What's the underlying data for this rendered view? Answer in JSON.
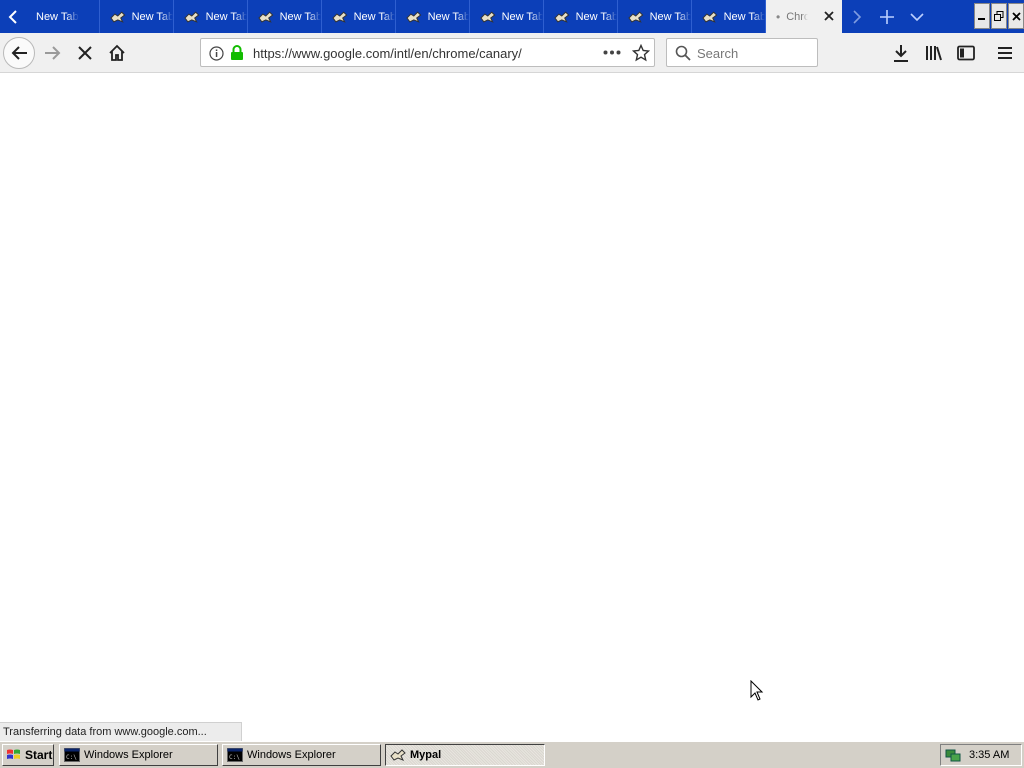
{
  "tabs": {
    "background_tabs": [
      {
        "title": "New Tab"
      },
      {
        "title": "New Tab"
      },
      {
        "title": "New Tab"
      },
      {
        "title": "New Tab"
      },
      {
        "title": "New Tab"
      },
      {
        "title": "New Tab"
      },
      {
        "title": "New Tab"
      },
      {
        "title": "New Tab"
      },
      {
        "title": "New Tab"
      },
      {
        "title": "New Tab"
      }
    ],
    "active_tab": {
      "title": "Chrome Canary"
    }
  },
  "navbar": {
    "url": "https://www.google.com/intl/en/chrome/canary/",
    "search_placeholder": "Search"
  },
  "status": {
    "text": "Transferring data from www.google.com..."
  },
  "taskbar": {
    "start_label": "Start",
    "tasks": [
      {
        "label": "Windows Explorer"
      },
      {
        "label": "Windows Explorer"
      },
      {
        "label": "Mypal"
      }
    ],
    "clock": "3:35 AM"
  },
  "colors": {
    "tabstrip": "#0c3fb8",
    "toolbar": "#f0f0f0",
    "lock_green": "#12bc00",
    "taskbar": "#d4d0c8"
  }
}
